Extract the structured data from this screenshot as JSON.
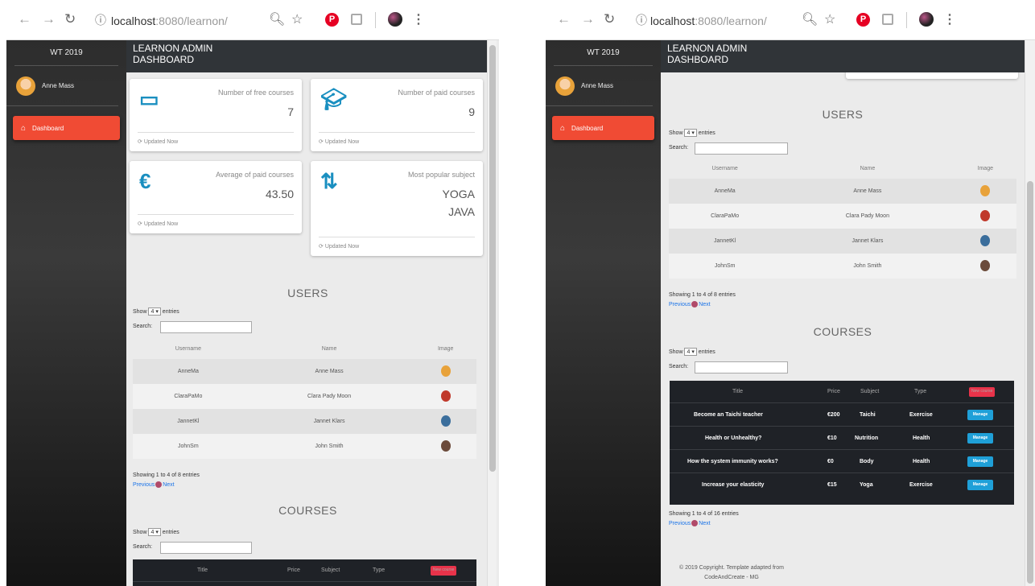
{
  "browser": {
    "url_host": "localhost",
    "url_rest": ":8080/learnon/"
  },
  "app": {
    "year_label": "WT 2019",
    "title_line1": "LEARNON ADMIN",
    "title_line2": "DASHBOARD",
    "user_name": "Anne Mass",
    "nav_dashboard": "Dashboard",
    "accent_color": "#f04b34"
  },
  "stats": [
    {
      "label": "Number of free courses",
      "value": "7",
      "footer": "Updated Now",
      "icon": "laptop-icon"
    },
    {
      "label": "Number of paid courses",
      "value": "9",
      "footer": "Updated Now",
      "icon": "graduation-cap-icon"
    },
    {
      "label": "Average of paid courses",
      "value": "43.50",
      "footer": "Updated Now",
      "icon": "euro-icon"
    },
    {
      "label": "Most popular subject",
      "value": "YOGA",
      "value2": "JAVA",
      "footer": "Updated Now",
      "icon": "sort-icon"
    }
  ],
  "users": {
    "heading": "USERS",
    "show": "Show",
    "length": "4",
    "entries": "entries",
    "search": "Search:",
    "columns": [
      "Username",
      "Name",
      "Image"
    ],
    "rows": [
      {
        "username": "AnneMa",
        "name": "Anne Mass"
      },
      {
        "username": "ClaraPaMo",
        "name": "Clara Pady Moon"
      },
      {
        "username": "JannetKl",
        "name": "Jannet Klars"
      },
      {
        "username": "JohnSm",
        "name": "John Smith"
      }
    ],
    "info": "Showing 1 to 4 of 8 entries",
    "prev": "Previous",
    "next": "Next"
  },
  "courses": {
    "heading": "COURSES",
    "show": "Show",
    "length": "4",
    "entries": "entries",
    "search": "Search:",
    "columns": [
      "Title",
      "Price",
      "Subject",
      "Type"
    ],
    "new_button": "New course",
    "manage_button": "Manage",
    "rows": [
      {
        "title": "Become an Taichi teacher",
        "price": "€200",
        "subject": "Taichi",
        "type": "Exercise"
      },
      {
        "title": "Health or Unhealthy?",
        "price": "€10",
        "subject": "Nutrition",
        "type": "Health"
      },
      {
        "title": "How the system immunity works?",
        "price": "€0",
        "subject": "Body",
        "type": "Health"
      },
      {
        "title": "Increase your elasticity",
        "price": "€15",
        "subject": "Yoga",
        "type": "Exercise"
      }
    ],
    "info": "Showing 1 to 4 of 16 entries",
    "prev": "Previous",
    "next": "Next"
  },
  "footer": {
    "line1": "© 2019 Copyright. Template adapted from",
    "line2": "CodeAndCreate - MG"
  }
}
